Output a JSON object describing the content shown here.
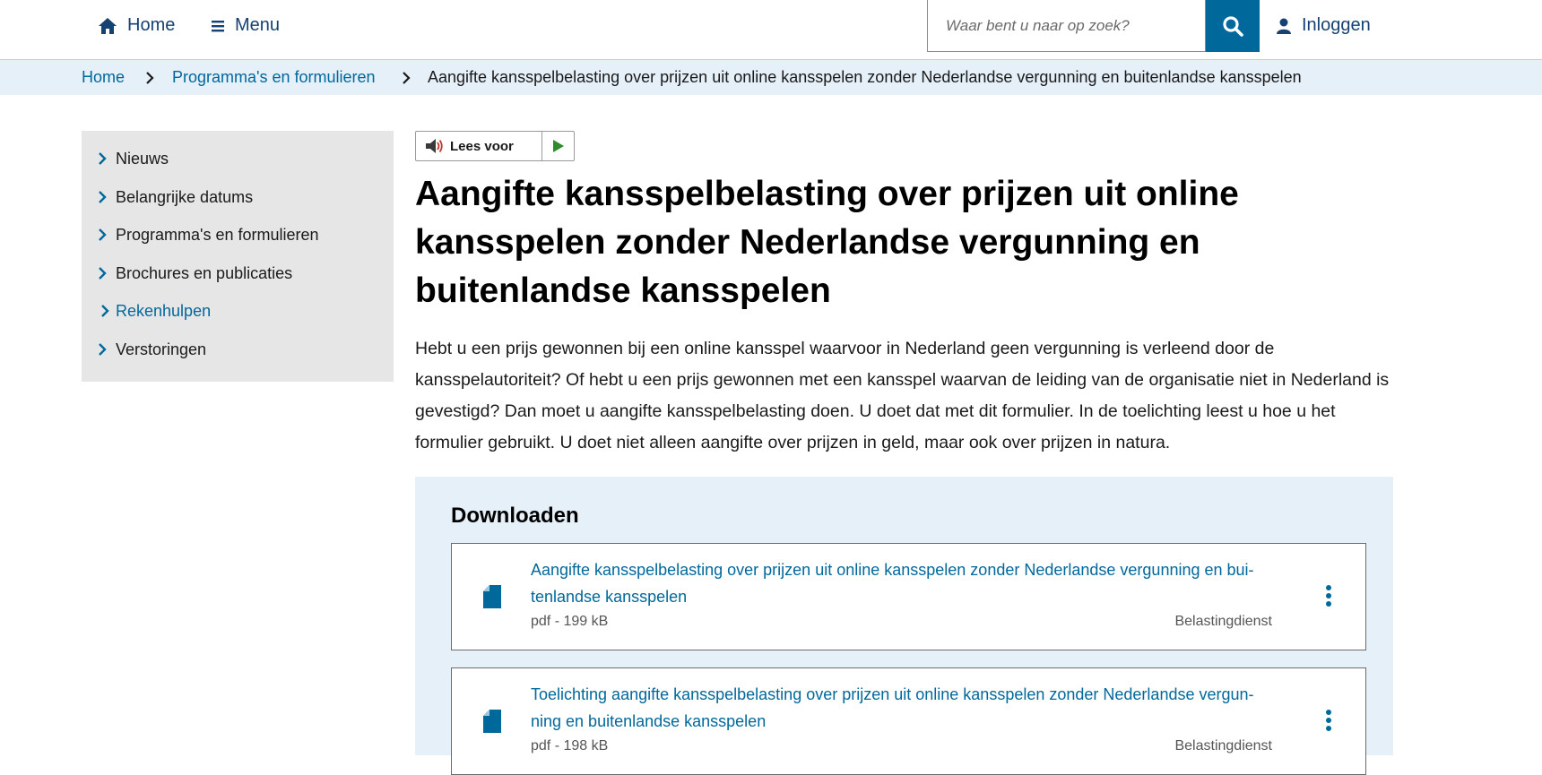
{
  "header": {
    "home_label": "Home",
    "menu_label": "Menu",
    "search_placeholder": "Waar bent u naar op zoek?",
    "login_label": "Inloggen"
  },
  "breadcrumb": [
    {
      "label": "Home"
    },
    {
      "label": "Programma's en formulieren"
    },
    {
      "label": "Aangifte kansspelbelasting over prijzen uit online kansspelen zonder Nederlandse vergunning en buitenlandse kansspelen"
    }
  ],
  "sidebar": {
    "items": [
      {
        "label": "Nieuws"
      },
      {
        "label": "Belangrijke datums"
      },
      {
        "label": "Programma's en formulieren"
      },
      {
        "label": "Brochures en publicaties"
      },
      {
        "label": "Rekenhulpen"
      },
      {
        "label": "Verstoringen"
      }
    ]
  },
  "readspeaker": {
    "label": "Lees voor"
  },
  "main": {
    "title": "Aangifte kansspelbelasting over prijzen uit online kansspelen zonder Nederlandse vergunning en buitenlandse kansspelen",
    "intro": "Hebt u een prijs gewonnen bij een online kansspel waarvoor in Nederland geen vergunning is verleend door de kansspelautoriteit? Of hebt u een prijs gewonnen met een kansspel waarvan de leiding van de organisatie niet in Nederland is gevestigd? Dan moet u aangifte kansspelbelasting doen. U doet dat met dit formulier. In de toelichting leest u hoe u het formulier gebruikt. U doet niet alleen aangifte over prijzen in geld, maar ook over prijzen in natura."
  },
  "downloads": {
    "title": "Downloaden",
    "items": [
      {
        "title": "Aangifte kansspelbelasting over prijzen uit online kansspelen zonder Nederlandse vergunning en bui­tenlandse kansspelen",
        "meta": "pdf - 199 kB",
        "source": "Belastingdienst"
      },
      {
        "title": "Toelichting aangifte kansspelbelasting over prijzen uit online kansspelen zonder Nederlandse vergun­ning en buitenlandse kansspelen",
        "meta": "pdf - 198 kB",
        "source": "Belastingdienst"
      }
    ]
  },
  "colors": {
    "brand_blue": "#01689b",
    "header_text": "#154273",
    "breadcrumb_bg": "#e5f0f9",
    "sidebar_bg": "#e6e6e6",
    "downloads_bg": "#e5f0f9",
    "play_green": "#2e8b2e"
  },
  "icons": [
    "home-icon",
    "menu-icon",
    "search-icon",
    "user-icon",
    "chevron-right-icon",
    "speaker-icon",
    "play-icon",
    "file-icon",
    "more-vertical-icon"
  ]
}
